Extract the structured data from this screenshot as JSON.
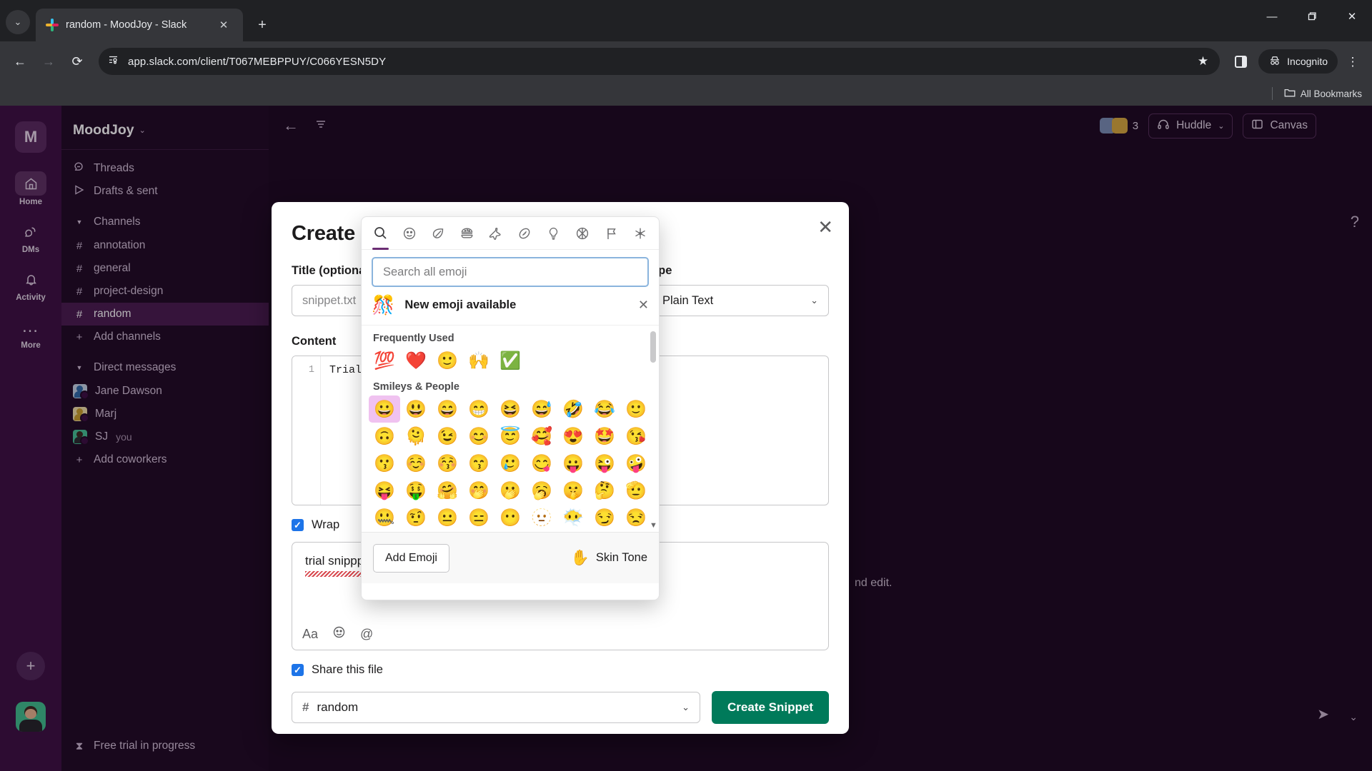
{
  "browser": {
    "tab": {
      "title": "random - MoodJoy - Slack",
      "close_icon": "close-icon",
      "favicon": "slack-favicon"
    },
    "new_tab_label": "+",
    "tabstrip_arrow": "⌄",
    "window": {
      "minimize": "—",
      "maximize": "❐",
      "close": "✕"
    },
    "nav": {
      "back": "←",
      "forward": "→",
      "reload": "⟳"
    },
    "omnibox": {
      "site_icon": "page-info-icon",
      "url": "app.slack.com/client/T067MEBPPUY/C066YESN5DY",
      "star_icon": "★"
    },
    "sidepanel_icon": "side-panel-icon",
    "incognito": {
      "label": "Incognito",
      "icon": "incognito-icon"
    },
    "menu_icon": "⋮",
    "bookmarks": {
      "label": "All Bookmarks",
      "icon": "folder-icon"
    }
  },
  "slack": {
    "rail": {
      "workspace_initial": "M",
      "items": [
        {
          "label": "Home",
          "icon": "home-icon",
          "active": true
        },
        {
          "label": "DMs",
          "icon": "dms-icon",
          "active": false
        },
        {
          "label": "Activity",
          "icon": "bell-icon",
          "active": false
        },
        {
          "label": "More",
          "icon": "ellipsis-icon",
          "active": false
        }
      ],
      "add_label": "+",
      "avatar": "user-avatar"
    },
    "sidebar": {
      "workspace": "MoodJoy",
      "caret": "⌄",
      "quick": [
        {
          "label": "Threads",
          "icon": "threads-icon"
        },
        {
          "label": "Drafts & sent",
          "icon": "drafts-icon"
        }
      ],
      "channels_section": "Channels",
      "channels": [
        {
          "label": "annotation",
          "selected": false
        },
        {
          "label": "general",
          "selected": false
        },
        {
          "label": "project-design",
          "selected": false
        },
        {
          "label": "random",
          "selected": true
        }
      ],
      "add_channels": "Add channels",
      "dm_section": "Direct messages",
      "dms": [
        {
          "label": "Jane Dawson",
          "color": "#3b7ec4",
          "body": "#2e5f96",
          "suffix": ""
        },
        {
          "label": "Marj",
          "color": "#d9b63a",
          "body": "#b99425",
          "suffix": ""
        },
        {
          "label": "SJ",
          "color": "#3fbf8f",
          "body": "#2a2b30",
          "suffix": "you"
        }
      ],
      "add_coworkers": "Add coworkers",
      "trial": {
        "label": "Free trial in progress",
        "icon": "hourglass-icon"
      }
    },
    "channel_header": {
      "back_icon": "back-arrow-icon",
      "filter_icon": "filter-icon",
      "member_count": "3",
      "huddle_label": "Huddle",
      "huddle_icon": "headphones-icon",
      "huddle_caret": "⌄",
      "canvas_label": "Canvas",
      "canvas_icon": "canvas-icon",
      "help_icon": "?"
    },
    "chat_fragment": "nd edit.",
    "composer": {
      "send_icon": "➤",
      "caret": "⌄"
    }
  },
  "modal": {
    "title": "Create sn",
    "close_icon": "✕",
    "title_label": "Title (optiona",
    "title_placeholder": "snippet.txt",
    "type_label": "ype",
    "type_value": "Plain Text",
    "type_caret": "⌄",
    "content_label": "Content",
    "code_line_number": "1",
    "code_text": "Trial",
    "wrap_label": "Wrap",
    "message_text": "trial snippp",
    "message_tools": {
      "format": "Aa",
      "emoji": "emoji-icon",
      "mention": "@"
    },
    "share_label": "Share this file",
    "channel_value": "random",
    "channel_hash": "#",
    "channel_caret": "⌄",
    "submit_label": "Create Snippet"
  },
  "picker": {
    "tabs": [
      {
        "name": "search-icon",
        "glyph": "⌕",
        "active": true
      },
      {
        "name": "smiley-icon",
        "glyph": "☺",
        "active": false
      },
      {
        "name": "leaf-icon",
        "glyph": "🍃",
        "active": false
      },
      {
        "name": "food-icon",
        "glyph": "🍔",
        "active": false
      },
      {
        "name": "travel-icon",
        "glyph": "✈",
        "active": false
      },
      {
        "name": "activity-icon",
        "glyph": "🏈",
        "active": false
      },
      {
        "name": "objects-icon",
        "glyph": "💡",
        "active": false
      },
      {
        "name": "symbols-icon",
        "glyph": "☮",
        "active": false
      },
      {
        "name": "flags-icon",
        "glyph": "⚑",
        "active": false
      },
      {
        "name": "custom-icon",
        "glyph": "⁂",
        "active": false
      }
    ],
    "search_placeholder": "Search all emoji",
    "banner": {
      "emoji": "🎊",
      "text": "New emoji available",
      "close": "✕"
    },
    "frequently_used_label": "Frequently Used",
    "frequently_used": [
      "💯",
      "❤️",
      "🙂",
      "🙌",
      "✅"
    ],
    "smileys_label": "Smileys & People",
    "smileys": [
      "😀",
      "😃",
      "😄",
      "😁",
      "😆",
      "😅",
      "🤣",
      "😂",
      "🙂",
      "🙃",
      "🫠",
      "😉",
      "😊",
      "😇",
      "🥰",
      "😍",
      "🤩",
      "😘",
      "😗",
      "☺️",
      "😚",
      "😙",
      "🥲",
      "😋",
      "😛",
      "😜",
      "🤪",
      "😝",
      "🤑",
      "🤗",
      "🤭",
      "🫢",
      "🥱",
      "🤫",
      "🤔",
      "🫡",
      "🤐",
      "🤨",
      "😐",
      "😑",
      "😶",
      "🫥",
      "😶‍🌫️",
      "😏",
      "😒"
    ],
    "footer": {
      "add_emoji": "Add Emoji",
      "skin_tone": "Skin Tone",
      "hand": "✋"
    },
    "scroll_down": "▼"
  },
  "colors": {
    "slack_aubergine": "#3d1042",
    "slack_green": "#007a5a",
    "accent_purple": "#6b2d73",
    "checkbox_blue": "#1d74e8",
    "browser_dark": "#202124",
    "browser_toolbar": "#35363a"
  }
}
